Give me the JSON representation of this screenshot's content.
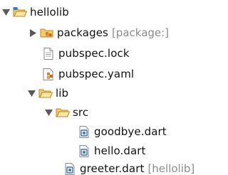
{
  "tree": {
    "root": {
      "label": "hellolib",
      "icon": "project-folder-icon",
      "expanded": true
    },
    "packages": {
      "label": "packages",
      "decoration": "[package:]",
      "icon": "packages-folder-icon",
      "expanded": false
    },
    "pubspec_lock": {
      "label": "pubspec.lock",
      "icon": "text-file-icon"
    },
    "pubspec_yaml": {
      "label": "pubspec.yaml",
      "icon": "yaml-file-icon"
    },
    "lib": {
      "label": "lib",
      "icon": "folder-open-icon",
      "expanded": true
    },
    "src": {
      "label": "src",
      "icon": "folder-open-icon",
      "expanded": true
    },
    "goodbye": {
      "label": "goodbye.dart",
      "icon": "dart-file-icon"
    },
    "hello": {
      "label": "hello.dart",
      "icon": "dart-file-icon"
    },
    "greeter": {
      "label": "greeter.dart",
      "decoration": "[hellolib]",
      "icon": "dart-file-icon"
    }
  },
  "colors": {
    "folder_fill": "#f6d77a",
    "folder_stroke": "#c99a2e",
    "twisty": "#5a5a5a",
    "decoration_text": "#8c8c8c",
    "project_blue": "#3b78c8"
  }
}
